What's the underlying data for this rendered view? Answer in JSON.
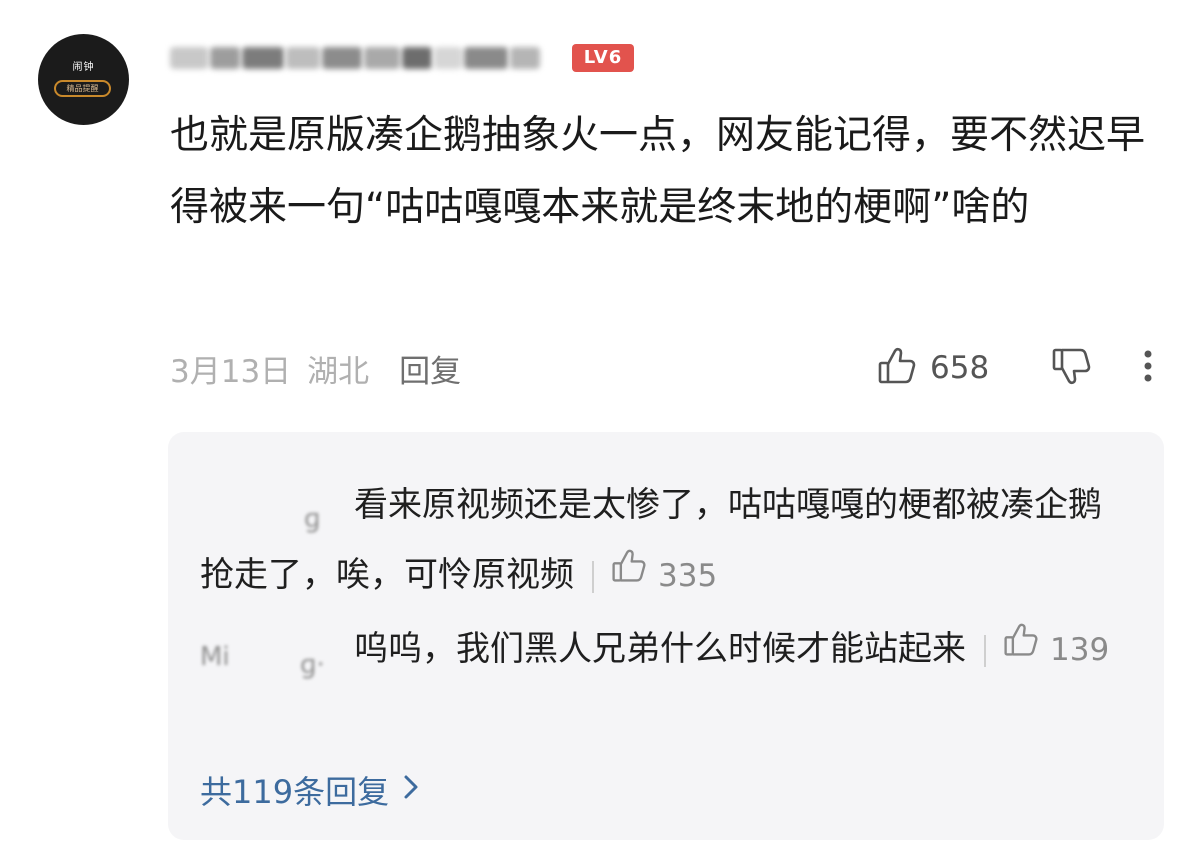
{
  "comment": {
    "avatar": {
      "name_text": "闹钟",
      "pill_text": "精品提醒"
    },
    "level_badge": "LV6",
    "text": "也就是原版凑企鹅抽象火一点，网友能记得，要不然迟早得被来一句“咕咕嘎嘎本来就是终末地的梗啊”啥的",
    "date": "3月13日",
    "location": "湖北",
    "reply_label": "回复",
    "like_count": "658"
  },
  "replies": {
    "items": [
      {
        "text": "看来原视频还是太惨了，咕咕嘎嘎的梗都被凑企鹅抢走了，唉，可怜原视频",
        "like_count": "335"
      },
      {
        "user_fragment": "Mi",
        "text": "呜呜，我们黑人兄弟什么时候才能站起来",
        "like_count": "139"
      }
    ],
    "view_all": "共119条回复"
  },
  "colors": {
    "badge": "#e2534d",
    "link": "#3d6b9e",
    "card_bg": "#f5f5f7"
  },
  "icons": {
    "like": "thumb-up-icon",
    "dislike": "thumb-down-icon",
    "more": "more-vertical-icon",
    "chevron": "chevron-right-icon"
  }
}
